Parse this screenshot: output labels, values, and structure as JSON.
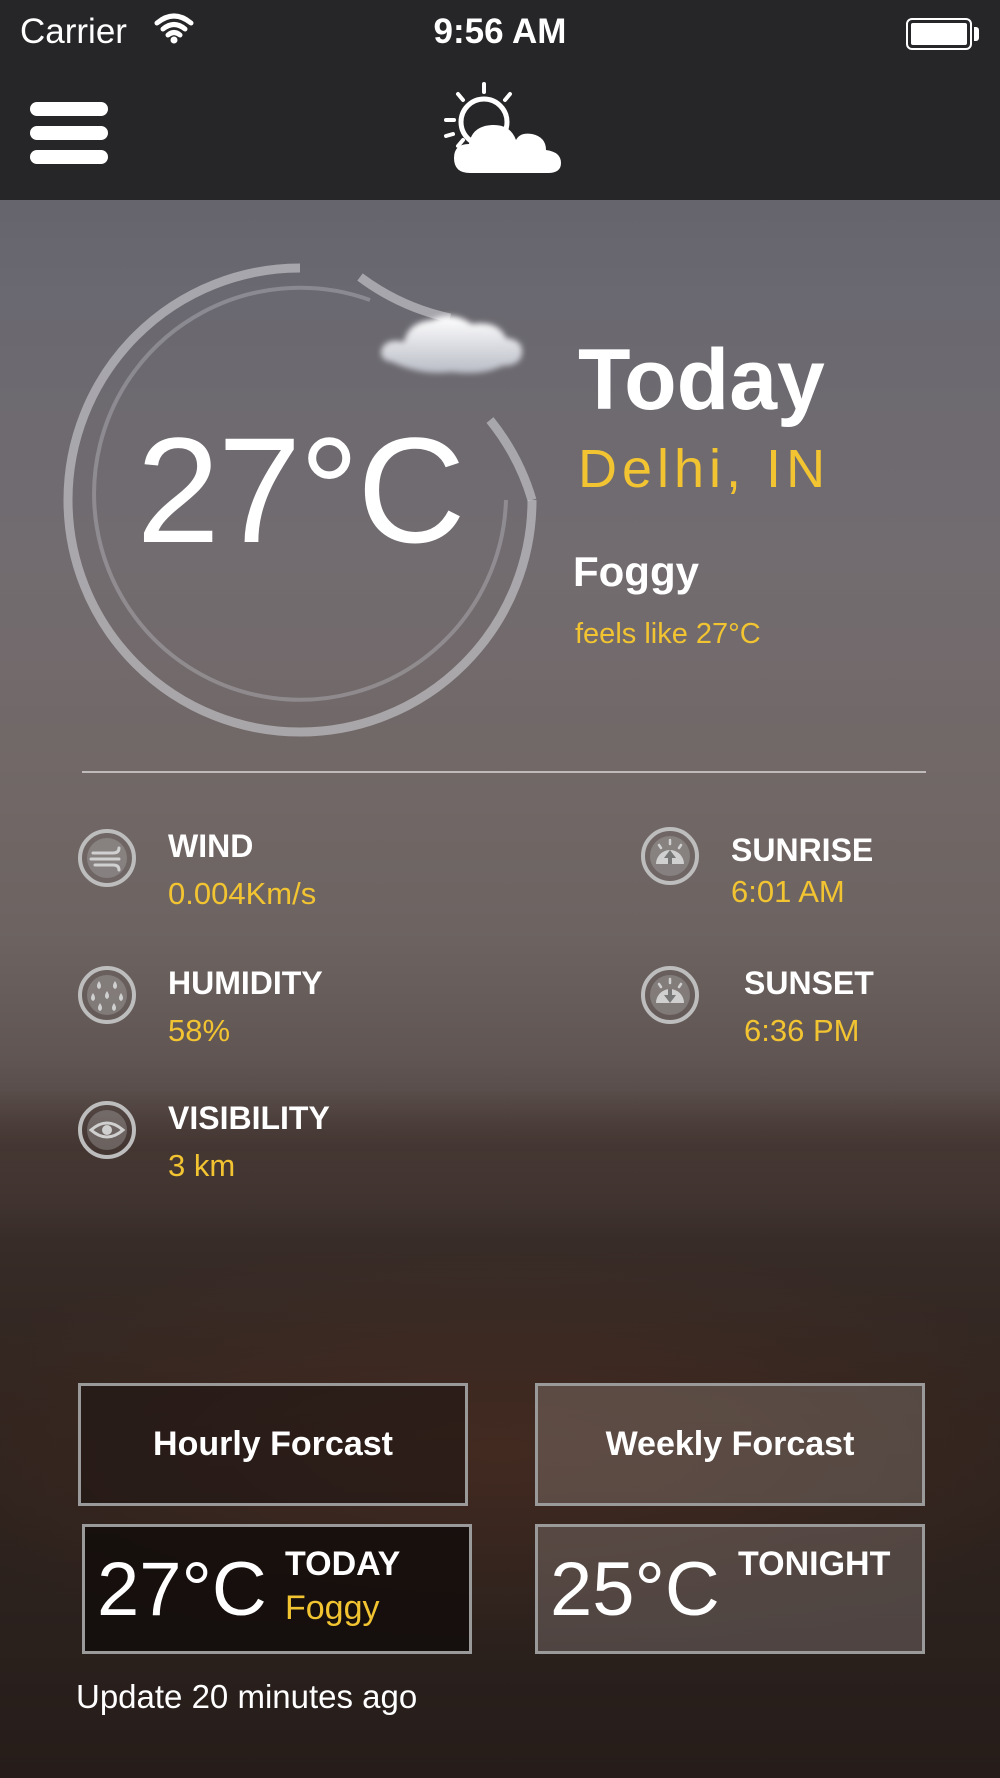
{
  "status_bar": {
    "carrier": "Carrier",
    "time": "9:56 AM",
    "wifi_icon": "wifi-icon",
    "battery_icon": "battery-icon"
  },
  "nav": {
    "menu_icon": "hamburger-menu-icon",
    "logo_icon": "partly-cloudy-sun-icon"
  },
  "current": {
    "temperature": "27°C",
    "title": "Today",
    "location": "Delhi, IN",
    "condition": "Foggy",
    "feels_like": "feels like 27°C",
    "condition_icon": "cloud-icon"
  },
  "stats": {
    "wind": {
      "label": "WIND",
      "value": "0.004Km/s",
      "icon": "wind-icon"
    },
    "humidity": {
      "label": "HUMIDITY",
      "value": "58%",
      "icon": "humidity-drops-icon"
    },
    "visibility": {
      "label": "VISIBILITY",
      "value": "3 km",
      "icon": "eye-icon"
    },
    "sunrise": {
      "label": "SUNRISE",
      "value": "6:01 AM",
      "icon": "sunrise-icon"
    },
    "sunset": {
      "label": "SUNSET",
      "value": "6:36 PM",
      "icon": "sunset-icon"
    }
  },
  "buttons": {
    "hourly": "Hourly Forcast",
    "weekly": "Weekly Forcast"
  },
  "cards": {
    "today": {
      "temp": "27°C",
      "label": "TODAY",
      "condition": "Foggy"
    },
    "tonight": {
      "temp": "25°C",
      "label": "TONIGHT"
    }
  },
  "footer": {
    "update_text": "Update 20 minutes ago"
  },
  "colors": {
    "accent": "#f2c431",
    "topbar": "#262628",
    "text": "#ffffff"
  }
}
